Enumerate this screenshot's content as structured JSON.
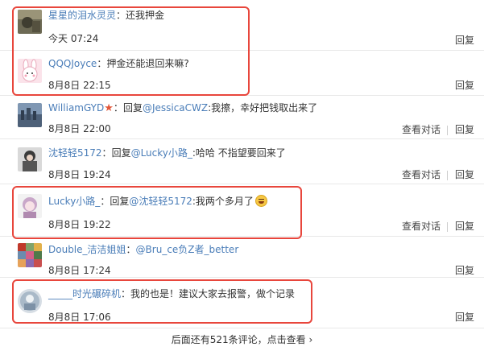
{
  "comments": [
    {
      "username": "星星的泪水灵灵",
      "sep": "：",
      "reply_prefix": "",
      "mention": "",
      "text": "还我押金",
      "time": "今天 07:24",
      "view_label": "",
      "reply_label": "回复"
    },
    {
      "username": "QQQJoyce",
      "sep": "：",
      "reply_prefix": "",
      "mention": "",
      "text": "押金还能退回来嘛?",
      "time": "8月8日 22:15",
      "view_label": "",
      "reply_label": "回复"
    },
    {
      "username": "WilliamGYD",
      "sep": "：",
      "reply_prefix": "回复",
      "mention": "@JessicaCWZ",
      "text": ":我擦，幸好把钱取出来了",
      "time": "8月8日 22:00",
      "view_label": "查看对话",
      "reply_label": "回复"
    },
    {
      "username": "沈轻轻5172",
      "sep": "：",
      "reply_prefix": "回复",
      "mention": "@Lucky小路_",
      "text": ":哈哈 不指望要回来了",
      "time": "8月8日 19:24",
      "view_label": "查看对话",
      "reply_label": "回复"
    },
    {
      "username": "Lucky小路_",
      "sep": "：",
      "reply_prefix": "回复",
      "mention": "@沈轻轻5172",
      "text": ":我两个多月了",
      "time": "8月8日 19:22",
      "view_label": "查看对话",
      "reply_label": "回复"
    },
    {
      "username": "Double_洁洁姐姐",
      "sep": "：",
      "reply_prefix": "",
      "mention": "@Bru_ce负Z者_better",
      "text": "",
      "time": "8月8日 17:24",
      "view_label": "",
      "reply_label": "回复"
    },
    {
      "username": "_____时光碾碎机",
      "sep": "：",
      "reply_prefix": "",
      "mention": "",
      "text": "我的也是！建议大家去报警，做个记录",
      "time": "8月8日 17:06",
      "view_label": "",
      "reply_label": "回复"
    }
  ],
  "footer": {
    "label": "后面还有521条评论，点击查看",
    "arrow": "›"
  },
  "colors": {
    "link": "#4a7db8",
    "highlight": "#e8463c"
  }
}
